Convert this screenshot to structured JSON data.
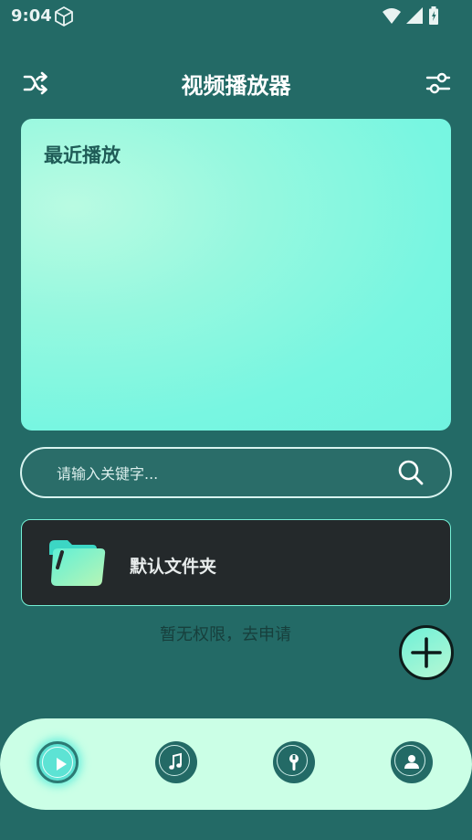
{
  "status_bar": {
    "time": "9:04"
  },
  "header": {
    "title": "视频播放器",
    "left_icon": "shuffle-icon",
    "right_icon": "sliders-icon"
  },
  "recent": {
    "title": "最近播放"
  },
  "search": {
    "placeholder": "请输入关键字..."
  },
  "folder": {
    "label": "默认文件夹",
    "icon": "folder-icon"
  },
  "permission_text": "暂无权限，去申请",
  "fab": {
    "icon": "plus-icon"
  },
  "bottom_nav": {
    "items": [
      {
        "icon": "play-icon",
        "active": true
      },
      {
        "icon": "music-note-icon",
        "active": false
      },
      {
        "icon": "tools-icon",
        "active": false
      },
      {
        "icon": "person-icon",
        "active": false
      }
    ]
  },
  "colors": {
    "background": "#236a66",
    "accent": "#74f0d5",
    "card_gradient_light": "#b9fbe2",
    "card_gradient": "#6ff3e0",
    "folder_card": "#24292b",
    "nav_background": "#cbffe6"
  }
}
